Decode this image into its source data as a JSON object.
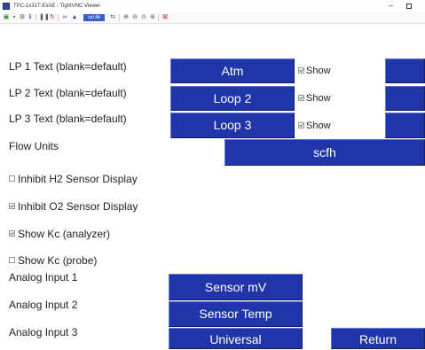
{
  "window": {
    "title": "TPC-1x31T-ExAE - TightVNC Viewer",
    "minimize_glyph": "–",
    "toolbar": {
      "ctrl_alt_label": "ctrl Alt",
      "icons": [
        "new-connection-icon",
        "save-icon",
        "options-icon",
        "info-icon",
        "pause-icon",
        "refresh-icon",
        "ctrl-alt-del-icon",
        "ctrl-esc-icon",
        "ctrl-alt-toggle",
        "transfer-icon",
        "zoom-in-icon",
        "zoom-out-icon",
        "zoom-100-icon",
        "zoom-fit-icon",
        "fullscreen-icon"
      ]
    }
  },
  "loops": [
    {
      "label": "LP 1 Text (blank=default)",
      "value": "Atm",
      "show_label": "Show",
      "show_checked": true
    },
    {
      "label": "LP 2 Text (blank=default)",
      "value": "Loop 2",
      "show_label": "Show",
      "show_checked": true
    },
    {
      "label": "LP 3 Text (blank=default)",
      "value": "Loop 3",
      "show_label": "Show",
      "show_checked": true
    }
  ],
  "flow_units": {
    "label": "Flow Units",
    "value": "scfh"
  },
  "options": [
    {
      "label": "Inhibit H2 Sensor Display",
      "checked": false
    },
    {
      "label": "Inhibit O2 Sensor Display",
      "checked": true
    },
    {
      "label": "Show Kc (analyzer)",
      "checked": true
    },
    {
      "label": "Show Kc (probe)",
      "checked": false
    }
  ],
  "analog_inputs": [
    {
      "label": "Analog Input 1",
      "value": "Sensor mV"
    },
    {
      "label": "Analog Input 2",
      "value": "Sensor Temp"
    },
    {
      "label": "Analog Input 3",
      "value": "Universal"
    }
  ],
  "return_label": "Return",
  "colors": {
    "button_bg": "#2036a8",
    "checkbox_check": "#3a8a3a"
  }
}
